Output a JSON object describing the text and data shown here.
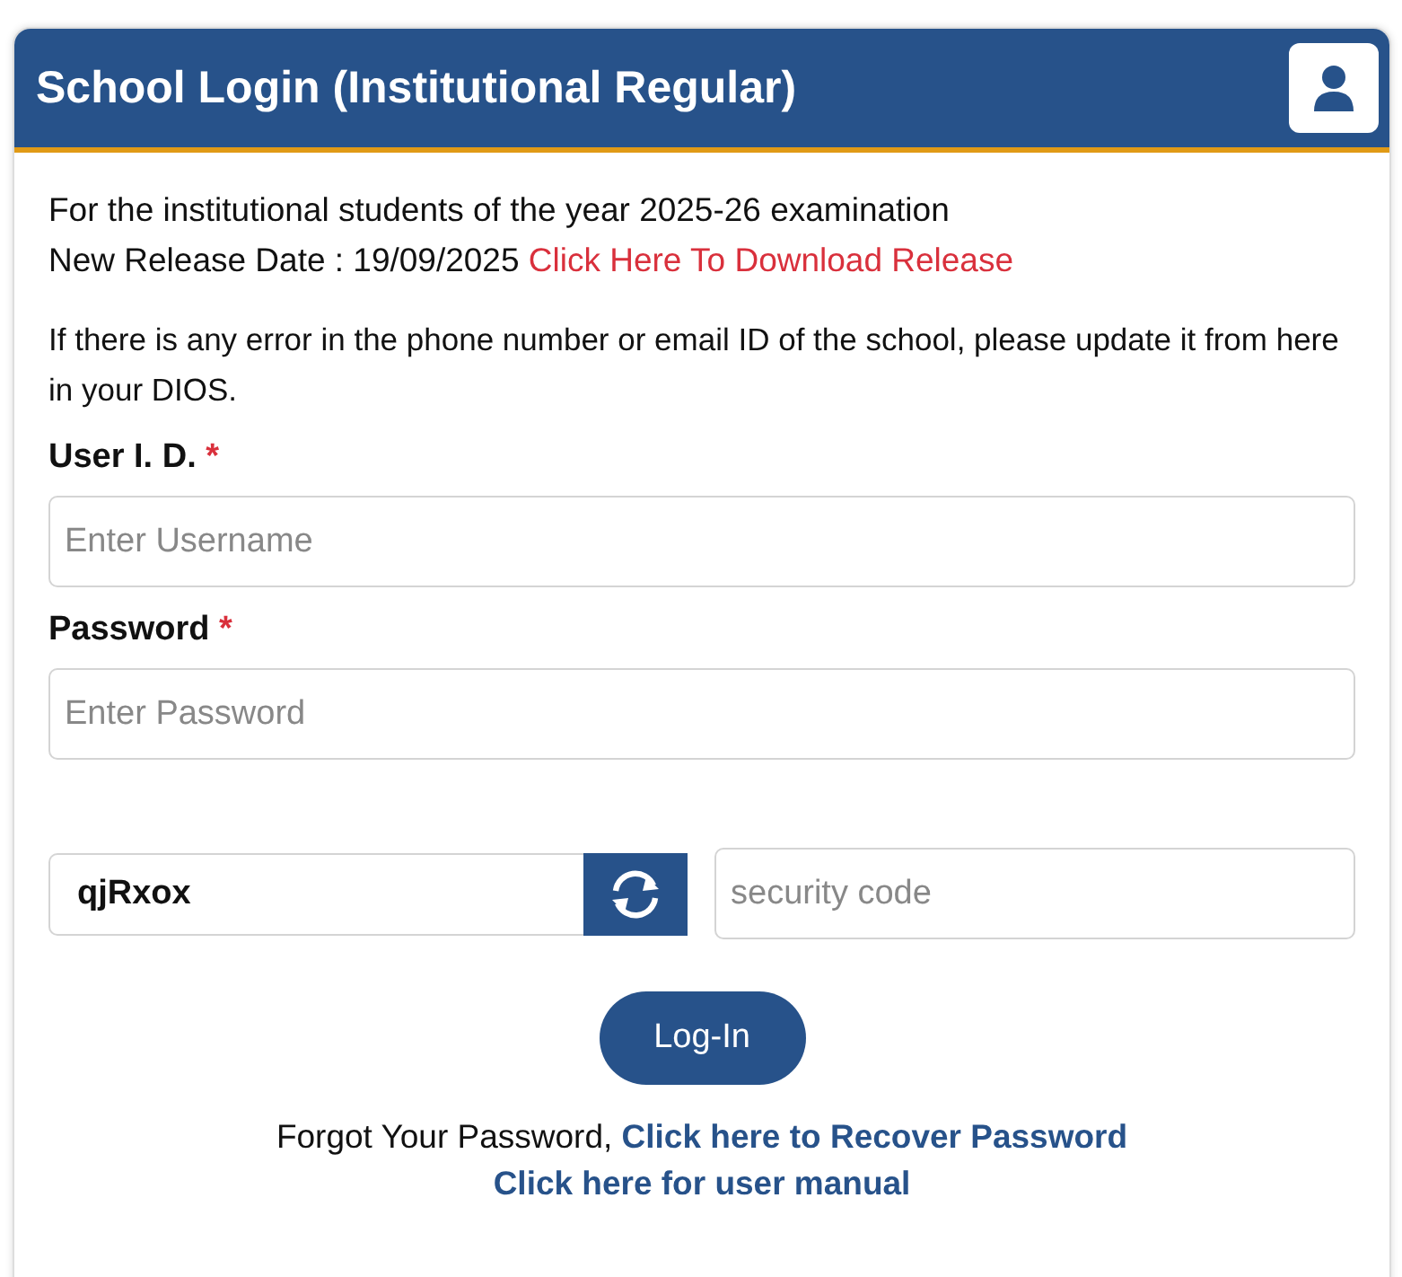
{
  "header": {
    "title": "School Login (Institutional Regular)"
  },
  "notice": {
    "line_1": "For the institutional students of the year 2025-26 examination",
    "release_label": "New Release Date : 19/09/2025",
    "release_link": "Click Here To Download Release",
    "info": "If there is any error in the phone number or email ID of the school, please update it from here in your DIOS."
  },
  "fields": [
    {
      "label": "User I. D.",
      "required_mark": "*",
      "placeholder": "Enter Username"
    },
    {
      "label": "Password",
      "required_mark": "*",
      "placeholder": "Enter Password"
    }
  ],
  "captcha": {
    "code": "qjRxox",
    "placeholder": "security code"
  },
  "login_button": "Log-In",
  "forgot": {
    "text": "Forgot Your Password,",
    "link": "Click here to Recover Password"
  },
  "manual_link": "Click here for user manual"
}
